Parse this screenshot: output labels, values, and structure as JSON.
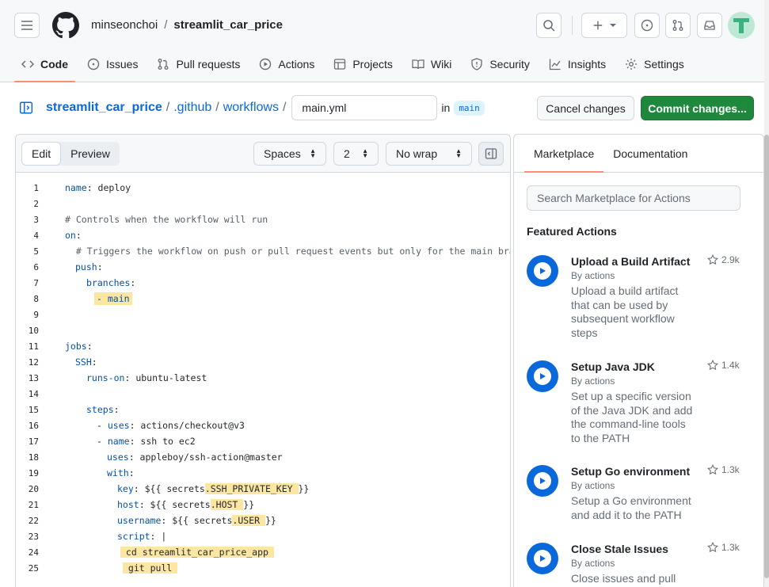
{
  "header": {
    "owner": "minseonchoi",
    "separator": "/",
    "repo": "streamlit_car_price"
  },
  "tabs": [
    {
      "label": "Code",
      "icon": "code-icon"
    },
    {
      "label": "Issues",
      "icon": "issue-icon"
    },
    {
      "label": "Pull requests",
      "icon": "pull-request-icon"
    },
    {
      "label": "Actions",
      "icon": "play-icon"
    },
    {
      "label": "Projects",
      "icon": "table-icon"
    },
    {
      "label": "Wiki",
      "icon": "book-icon"
    },
    {
      "label": "Security",
      "icon": "shield-icon"
    },
    {
      "label": "Insights",
      "icon": "graph-icon"
    },
    {
      "label": "Settings",
      "icon": "gear-icon"
    }
  ],
  "breadcrumb": {
    "repo": "streamlit_car_price",
    "dir1": ".github",
    "dir2": "workflows",
    "filename": "main.yml",
    "in_label": "in",
    "branch": "main"
  },
  "actions": {
    "cancel": "Cancel changes",
    "commit": "Commit changes..."
  },
  "editor": {
    "mode_edit": "Edit",
    "mode_preview": "Preview",
    "indent_mode": "Spaces",
    "indent_size": "2",
    "wrap_mode": "No wrap"
  },
  "sidebar": {
    "tab_marketplace": "Marketplace",
    "tab_documentation": "Documentation",
    "search_placeholder": "Search Marketplace for Actions",
    "featured_title": "Featured Actions",
    "items": [
      {
        "title": "Upload a Build Artifact",
        "by": "By actions",
        "desc": "Upload a build artifact that can be used by subsequent workflow steps",
        "stars": "2.9k"
      },
      {
        "title": "Setup Java JDK",
        "by": "By actions",
        "desc": "Set up a specific version of the Java JDK and add the command-line tools to the PATH",
        "stars": "1.4k"
      },
      {
        "title": "Setup Go environment",
        "by": "By actions",
        "desc": "Setup a Go environment and add it to the PATH",
        "stars": "1.3k"
      },
      {
        "title": "Close Stale Issues",
        "by": "By actions",
        "desc": "Close issues and pull",
        "stars": "1.3k"
      }
    ]
  },
  "code_lines": [
    "1",
    "2",
    "3",
    "4",
    "5",
    "6",
    "7",
    "8",
    "9",
    "10",
    "11",
    "12",
    "13",
    "14",
    "15",
    "16",
    "17",
    "18",
    "19",
    "20",
    "21",
    "22",
    "23",
    "24",
    "25"
  ],
  "code": {
    "l1_key": "name",
    "l1_val": ": deploy",
    "l3": "# Controls when the workflow will run",
    "l4_key": "on",
    "l4_val": ":",
    "l5": "  # Triggers the workflow on push or pull request events but only for the main branch",
    "l6_key": "push",
    "l6_val": ":",
    "l7_key": "branches",
    "l7_val": ":",
    "l8": "- main",
    "l11_key": "jobs",
    "l11_val": ":",
    "l12_key": "SSH",
    "l12_val": ":",
    "l13_key": "runs-on",
    "l13_val": ": ubuntu-latest",
    "l15_key": "steps",
    "l15_val": ":",
    "l16_dash": "- ",
    "l16_key": "uses",
    "l16_val": ": actions/checkout@v3",
    "l17_dash": "- ",
    "l17_key": "name",
    "l17_val": ": ssh to ec2",
    "l18_key": "uses",
    "l18_val": ": appleboy/ssh-action@master",
    "l19_key": "with",
    "l19_val": ":",
    "l20_key": "key",
    "l20_pre": ": ${{ secrets",
    "l20_hl": ".SSH_PRIVATE_KEY ",
    "l20_post": "}}",
    "l21_key": "host",
    "l21_pre": ": ${{ secrets",
    "l21_hl": ".HOST ",
    "l21_post": "}}",
    "l22_key": "username",
    "l22_pre": ": ${{ secrets",
    "l22_hl": ".USER ",
    "l22_post": "}}",
    "l23_key": "script",
    "l23_val": ": |",
    "l24": " cd streamlit_car_price_app ",
    "l25": " git pull "
  },
  "colors": {
    "accent_tab": "#fd8c73",
    "link": "#0969da",
    "commit_green": "#1f883d",
    "highlight": "#fbe6a2"
  }
}
